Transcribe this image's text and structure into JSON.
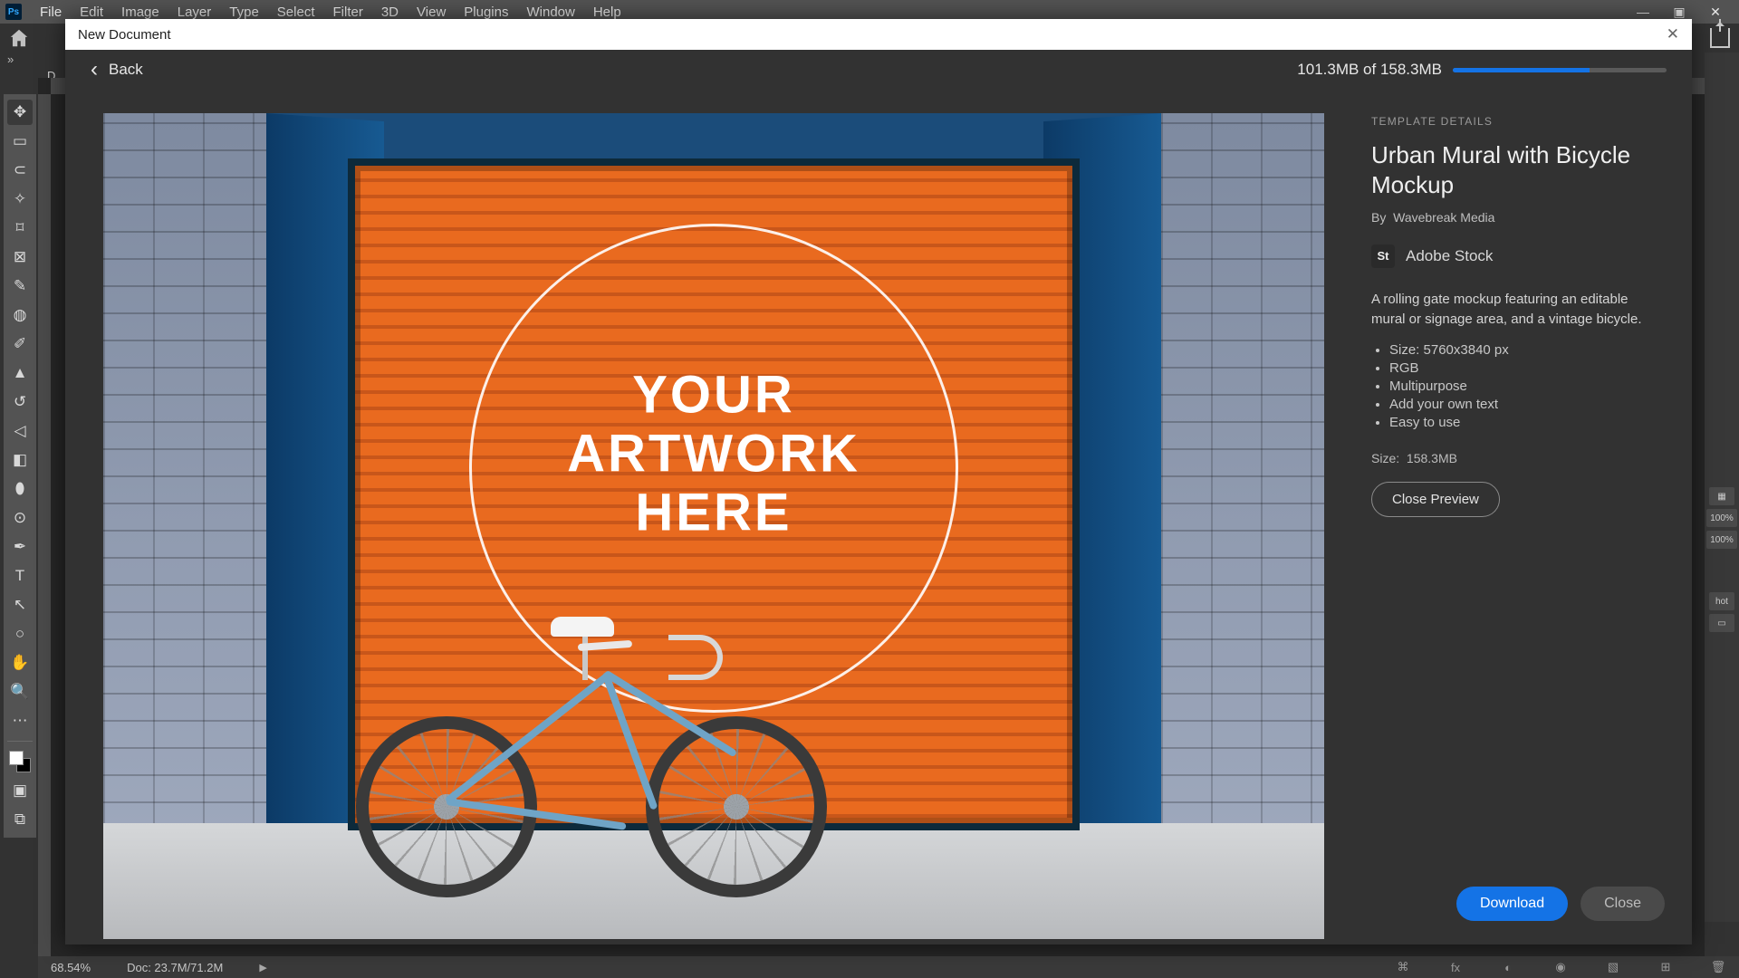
{
  "menubar": {
    "items": [
      "File",
      "Edit",
      "Image",
      "Layer",
      "Type",
      "Select",
      "Filter",
      "3D",
      "View",
      "Plugins",
      "Window",
      "Help"
    ]
  },
  "doc_tab_label": "D",
  "dialog": {
    "title": "New Document",
    "back_label": "Back",
    "progress_text": "101.3MB of 158.3MB",
    "progress_pct": 64
  },
  "artwork": {
    "line1": "YOUR",
    "line2": "ARTWORK",
    "line3": "HERE"
  },
  "details": {
    "header": "TEMPLATE DETAILS",
    "title": "Urban Mural with Bicycle Mockup",
    "by_prefix": "By",
    "author": "Wavebreak Media",
    "stock_badge": "St",
    "stock_label": "Adobe Stock",
    "description": "A rolling gate mockup featuring an editable mural or signage area, and a vintage bicycle.",
    "bullets": [
      "Size: 5760x3840 px",
      "RGB",
      "Multipurpose",
      "Add your own text",
      "Easy to use"
    ],
    "size_label": "Size:",
    "size_value": "158.3MB",
    "close_preview": "Close Preview",
    "download": "Download",
    "close": "Close"
  },
  "status": {
    "zoom": "68.54%",
    "doc": "Doc: 23.7M/71.2M"
  },
  "right_labels": [
    "100%",
    "100%",
    "hot"
  ]
}
